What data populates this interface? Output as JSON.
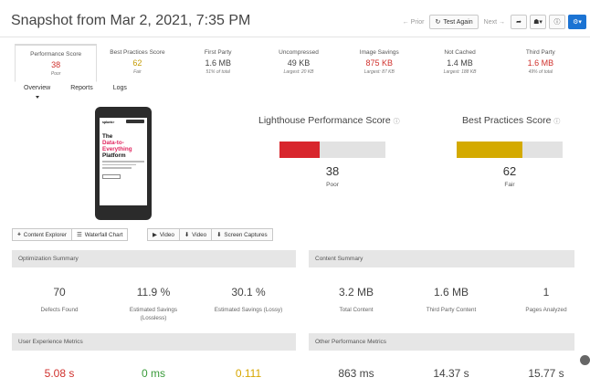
{
  "header": {
    "title": "Snapshot from Mar 2, 2021, 7:35 PM"
  },
  "toolbar": {
    "prior": "← Prior",
    "test_again": "Test Again",
    "next": "Next →",
    "share_icon": "share-icon",
    "user_icon": "user-icon",
    "info_icon": "info-icon",
    "settings_icon": "gear-icon"
  },
  "metrics": [
    {
      "label": "Performance Score",
      "value": "38",
      "sub": "Poor",
      "color": "#d0312d"
    },
    {
      "label": "Best Practices Score",
      "value": "62",
      "sub": "Fair",
      "color": "#c49a00"
    },
    {
      "label": "First Party",
      "value": "1.6 MB",
      "sub": "51% of total"
    },
    {
      "label": "Uncompressed",
      "value": "49 KB",
      "sub": "Largest: 20 KB"
    },
    {
      "label": "Image Savings",
      "value": "875 KB",
      "sub": "Largest: 87 KB",
      "color": "#d0312d"
    },
    {
      "label": "Not Cached",
      "value": "1.4 MB",
      "sub": "Largest: 188 KB"
    },
    {
      "label": "Third Party",
      "value": "1.6 MB",
      "sub": "49% of total",
      "color": "#d0312d"
    }
  ],
  "subtabs": [
    "Overview",
    "Reports",
    "Logs"
  ],
  "phone_screen": {
    "logo": "splunk>",
    "headline_1": "The",
    "headline_2": "Data-to-",
    "headline_3": "Everything",
    "headline_4": "Platform"
  },
  "gauges": {
    "performance": {
      "title": "Lighthouse Performance Score",
      "score": "38",
      "rating": "Poor",
      "fraction": 0.38,
      "color": "#d8262d"
    },
    "best_practices": {
      "title": "Best Practices Score",
      "score": "62",
      "rating": "Fair",
      "fraction": 0.62,
      "color": "#d4aa00"
    }
  },
  "left_buttons": [
    "Content Explorer",
    "Waterfall Chart"
  ],
  "right_buttons": [
    "Video",
    "Video",
    "Screen Captures"
  ],
  "optimization": {
    "title": "Optimization Summary",
    "stats": [
      {
        "value": "70",
        "label": "Defects Found"
      },
      {
        "value": "11.9 %",
        "label": "Estimated Savings (Lossless)"
      },
      {
        "value": "30.1 %",
        "label": "Estimated Savings (Lossy)"
      }
    ]
  },
  "content_summary": {
    "title": "Content Summary",
    "stats": [
      {
        "value": "3.2 MB",
        "label": "Total Content"
      },
      {
        "value": "1.6 MB",
        "label": "Third Party Content"
      },
      {
        "value": "1",
        "label": "Pages Analyzed"
      }
    ]
  },
  "ux_metrics": {
    "title": "User Experience Metrics",
    "stats": [
      {
        "value": "5.08 s",
        "color": "#d0312d"
      },
      {
        "value": "0 ms",
        "color": "#3a9b3a"
      },
      {
        "value": "0.111",
        "color": "#d7a600"
      }
    ]
  },
  "other_metrics": {
    "title": "Other Performance Metrics",
    "stats": [
      {
        "value": "863 ms"
      },
      {
        "value": "14.37 s"
      },
      {
        "value": "15.77 s"
      }
    ]
  }
}
